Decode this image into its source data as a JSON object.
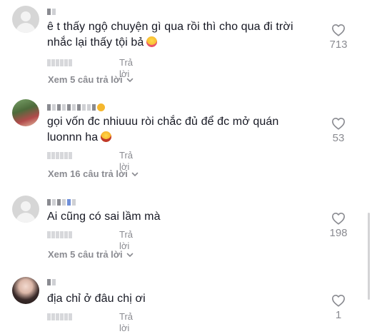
{
  "comments": [
    {
      "text_line1": "ê t thấy ngộ chuyện gì qua rồi thì cho qua đi trời",
      "text_line2": "nhắc lại thấy tội bả",
      "reply_label": "Trả lời",
      "likes": "713",
      "view_replies": "Xem 5 câu trả lời",
      "avatar": "default-avatar",
      "emoji": "crying-face"
    },
    {
      "text_line1": "gọi vốn đc nhiuuu ròi chắc đủ để đc mở quán",
      "text_line2": "luonnn ha",
      "reply_label": "Trả lời",
      "likes": "53",
      "view_replies": "Xem 16 câu trả lời",
      "avatar": "photo-avatar",
      "emoji": "laughing-face"
    },
    {
      "text_line1": "Ai cũng có sai lầm mà",
      "reply_label": "Trả lời",
      "likes": "198",
      "view_replies": "Xem 5 câu trả lời",
      "avatar": "default-avatar"
    },
    {
      "text_line1": "địa chỉ ở đâu chị ơi",
      "reply_label": "Trả lời",
      "likes": "1",
      "avatar": "photo-avatar"
    }
  ],
  "colors": {
    "text": "#161823",
    "muted": "#8a8b91",
    "heart_outline": "#8a8b91"
  },
  "icons": {
    "like": "heart-outline-icon",
    "expand": "chevron-down-icon"
  }
}
